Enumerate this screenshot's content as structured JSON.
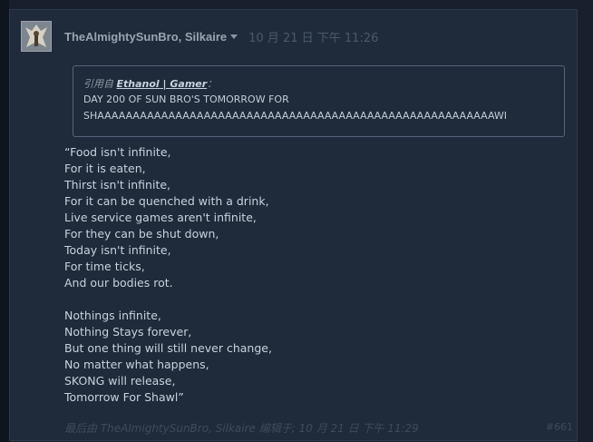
{
  "post": {
    "author": "TheAlmightySunBro, Silkaire",
    "timestamp": "10 月 21 日 下午 11:26",
    "quote": {
      "prefix": "引用自",
      "author": "Ethanol | Gamer",
      "suffix": "：",
      "lines": [
        "DAY 200 OF SUN BRO'S TOMORROW FOR",
        "SHAAAAAAAAAAAAAAAAAAAAAAAAAAAAAAAAAAAAAAAAAAAAAAAAAAAAAAAAWI"
      ]
    },
    "body_lines": [
      "“Food isn't infinite,",
      "For it is eaten,",
      "Thirst isn't infinite,",
      "For it can be quenched with a drink,",
      "Live service games aren't infinite,",
      "For they can be shut down,",
      "Today isn't infinite,",
      "For time ticks,",
      "And our bodies rot.",
      "",
      "Nothings infinite,",
      "Nothing Stays forever,",
      "But one thing will still never change,",
      "No matter what happens,",
      "SKONG will release,",
      "Tomorrow For Shawl”"
    ],
    "edit_note": "最后由 TheAlmightySunBro, Silkaire 编辑于; 10 月 21 日 下午 11:29",
    "post_number": "#661"
  },
  "icons": {
    "author_menu": "chevron-down-icon",
    "avatar": "avatar-image"
  },
  "colors": {
    "background": "#1f2b3b",
    "author": "#9aa4b0",
    "text": "#c8d2dc",
    "muted": "#4a5969"
  }
}
